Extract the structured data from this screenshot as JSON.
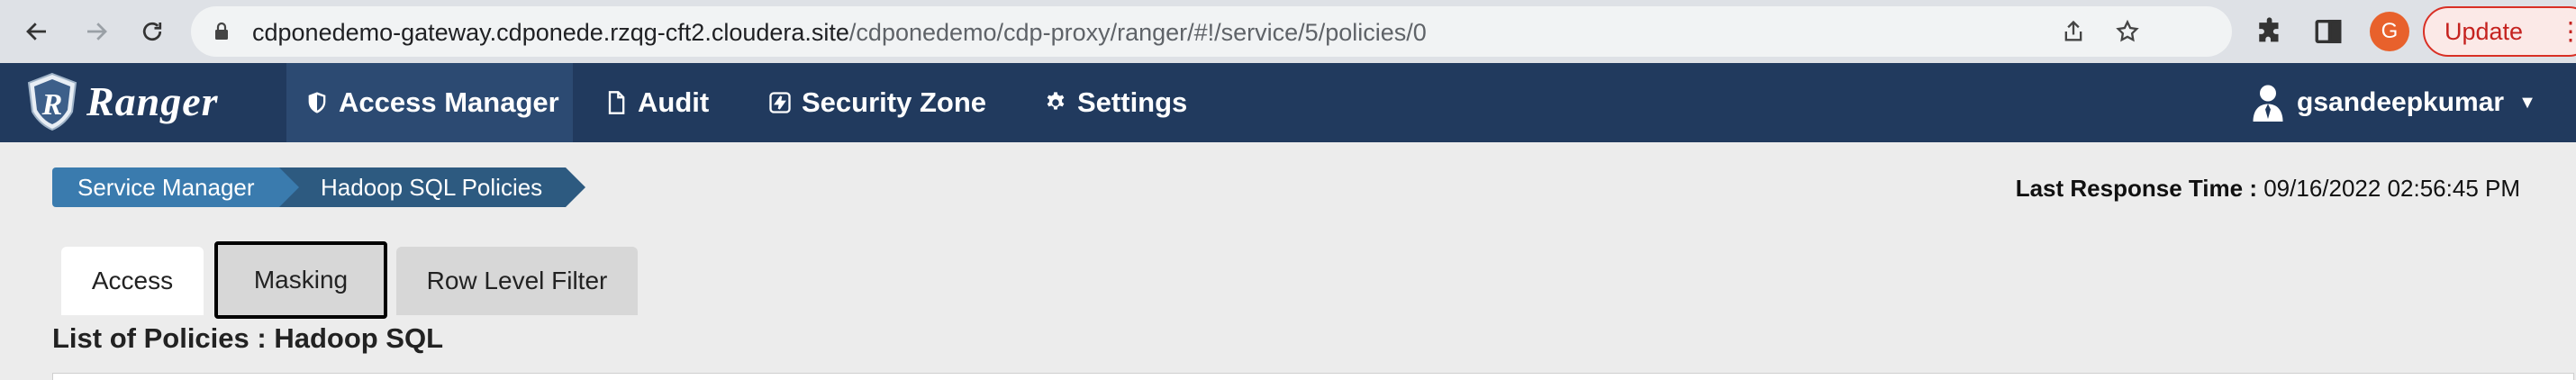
{
  "browser": {
    "url_host": "cdponedemo-gateway.cdponede.rzqg-cft2.cloudera.site",
    "url_path": "/cdponedemo/cdp-proxy/ranger/#!/service/5/policies/0",
    "profile_initial": "G",
    "update_label": "Update",
    "menu_dots": "⋮",
    "icons": [
      "back-arrow-icon",
      "forward-arrow-icon",
      "reload-icon",
      "lock-icon",
      "share-icon",
      "star-icon",
      "puzzle-icon",
      "sidepanel-icon"
    ]
  },
  "app": {
    "logo_text": "Ranger",
    "nav": [
      {
        "label": "Access Manager",
        "icon": "shield-icon",
        "active": true
      },
      {
        "label": "Audit",
        "icon": "file-icon"
      },
      {
        "label": "Security Zone",
        "icon": "bolt-icon"
      },
      {
        "label": "Settings",
        "icon": "gear-icon"
      }
    ],
    "user": "gsandeepkumar",
    "user_caret": "▼"
  },
  "breadcrumb": [
    "Service Manager",
    "Hadoop SQL Policies"
  ],
  "last_response": {
    "label": "Last Response Time :",
    "value": "09/16/2022 02:56:45 PM"
  },
  "tabs": [
    "Access",
    "Masking",
    "Row Level Filter"
  ],
  "list_title": "List of Policies : Hadoop SQL",
  "colors": {
    "nav_bg": "#213a5e",
    "crumb1": "#3a7bae",
    "crumb2": "#2d5a80",
    "update_red": "#d93025"
  }
}
